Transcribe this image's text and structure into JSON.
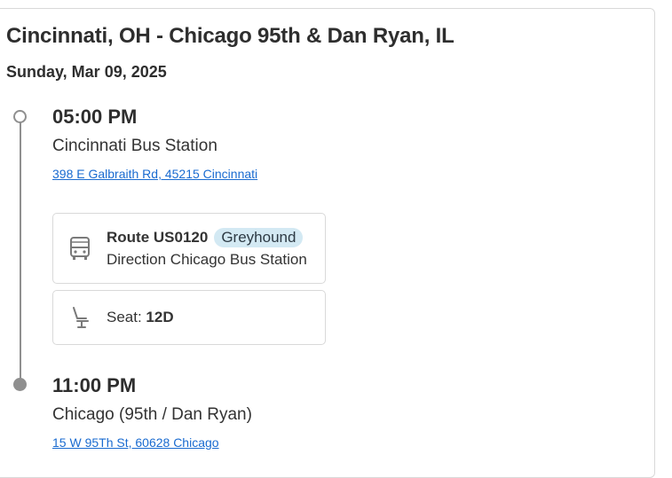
{
  "trip": {
    "title": "Cincinnati, OH - Chicago 95th & Dan Ryan, IL",
    "date": "Sunday, Mar 09, 2025"
  },
  "departure": {
    "time": "05:00 PM",
    "station": "Cincinnati Bus Station",
    "address": "398 E Galbraith Rd, 45215 Cincinnati"
  },
  "route": {
    "icon": "bus-icon",
    "label": "Route US0120",
    "operator": "Greyhound",
    "direction": "Direction Chicago Bus Station"
  },
  "seat": {
    "icon": "seat-icon",
    "label": "Seat:",
    "value": "12D"
  },
  "arrival": {
    "time": "11:00 PM",
    "station": "Chicago (95th / Dan Ryan)",
    "address": "15 W 95Th St, 60628 Chicago"
  },
  "colors": {
    "link": "#1a6bd0",
    "badge_bg": "#d3e9f3",
    "timeline": "#8f8f8f"
  }
}
